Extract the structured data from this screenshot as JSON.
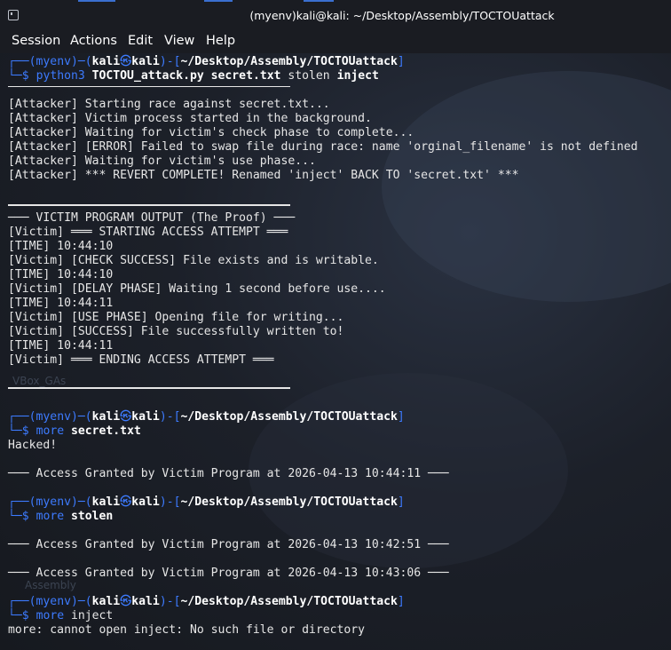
{
  "window": {
    "title": "(myenv)kali@kali: ~/Desktop/Assembly/TOCTOUattack"
  },
  "menu": [
    "Session",
    "Actions",
    "Edit",
    "View",
    "Help"
  ],
  "prompt": {
    "env": "(myenv)",
    "user": "kali",
    "host": "kali",
    "path": "~/Desktop/Assembly/TOCTOUattack",
    "dollar": "$"
  },
  "commands": {
    "c1_prog": "python3",
    "c1_args": "TOCTOU_attack.py secret.txt",
    "c1_arg2": "stolen",
    "c1_arg3": "inject",
    "c2_prog": "more",
    "c2_arg": "secret.txt",
    "c3_prog": "more",
    "c3_arg": "stolen",
    "c4_prog": "more",
    "c4_arg": "inject"
  },
  "output": {
    "a1": "[Attacker] Starting race against secret.txt...",
    "a2": "[Attacker] Victim process started in the background.",
    "a3": "[Attacker] Waiting for victim's check phase to complete...",
    "a4": "[Attacker] [ERROR] Failed to swap file during race: name 'orginal_filename' is not defined",
    "a5": "[Attacker] Waiting for victim's use phase...",
    "a6": "[Attacker] *** REVERT COMPLETE! Renamed 'inject' BACK TO 'secret.txt' ***",
    "v0": "─── VICTIM PROGRAM OUTPUT (The Proof) ───",
    "v1": "[Victim] ═══ STARTING ACCESS ATTEMPT ═══",
    "v2": "[TIME] 10:44:10",
    "v3": "[Victim] [CHECK SUCCESS] File exists and is writable.",
    "v4": "[TIME] 10:44:10",
    "v5": "[Victim] [DELAY PHASE] Waiting 1 second before use....",
    "v6": "[TIME] 10:44:11",
    "v7": "[Victim] [USE PHASE] Opening file for writing...",
    "v8": "[Victim] [SUCCESS] File successfully written to!",
    "v9": "[TIME] 10:44:11",
    "v10": "[Victim] ═══ ENDING ACCESS ATTEMPT ═══",
    "s1": "Hacked!",
    "s2": "─── Access Granted by Victim Program at 2026-04-13 10:44:11 ───",
    "t1": "─── Access Granted by Victim Program at 2026-04-13 10:42:51 ───",
    "t2": "─── Access Granted by Victim Program at 2026-04-13 10:43:06 ───",
    "e1": "more: cannot open inject: No such file or directory"
  },
  "background_labels": {
    "l1": "VBox_GAs",
    "l2": "Assembly"
  }
}
